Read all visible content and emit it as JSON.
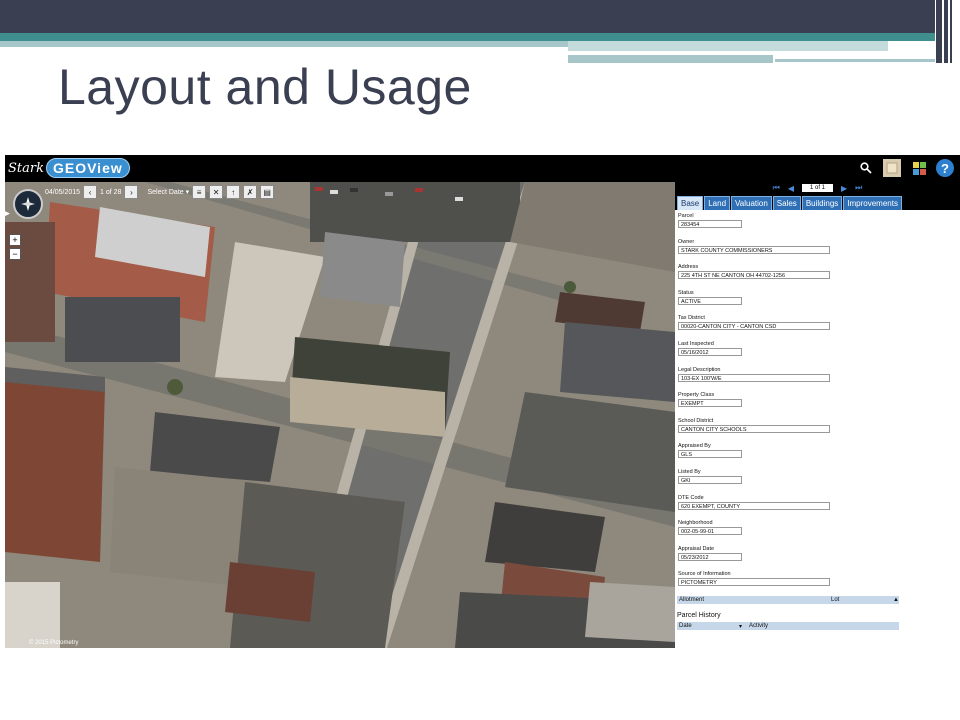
{
  "slide": {
    "title": "Layout and Usage"
  },
  "app": {
    "logo_stark": "Stark",
    "logo_geo": "GEOView"
  },
  "header_icons": {
    "search": "search-icon",
    "layers": "layers-icon",
    "grid": "grid-icon",
    "help_label": "?"
  },
  "map": {
    "date": "04/05/2015",
    "page_label": "1 of 28",
    "select_date": "Select Date",
    "zoom_in": "+",
    "zoom_out": "−",
    "copyright": "© 2015 Pictometry"
  },
  "pager": {
    "label": "1 of 1"
  },
  "tabs": [
    "Base",
    "Land",
    "Valuation",
    "Sales",
    "Buildings",
    "Improvements"
  ],
  "fields": [
    {
      "label": "Parcel",
      "value": "283454",
      "size": "short"
    },
    {
      "label": "Owner",
      "value": "STARK COUNTY COMMISSIONERS",
      "size": "long"
    },
    {
      "label": "Address",
      "value": "225 4TH ST NE CANTON OH 44702-1256",
      "size": "long"
    },
    {
      "label": "Status",
      "value": "ACTIVE",
      "size": "short"
    },
    {
      "label": "Tax District",
      "value": "00020-CANTON CITY - CANTON CSD",
      "size": "long"
    },
    {
      "label": "Last Inspected",
      "value": "05/16/2012",
      "size": "short"
    },
    {
      "label": "Legal Description",
      "value": "103-EX 100'W/E",
      "size": "long"
    },
    {
      "label": "Property Class",
      "value": "EXEMPT",
      "size": "short"
    },
    {
      "label": "School District",
      "value": "CANTON CITY SCHOOLS",
      "size": "long"
    },
    {
      "label": "Appraised By",
      "value": "GLS",
      "size": "short"
    },
    {
      "label": "Listed By",
      "value": "GKI",
      "size": "short"
    },
    {
      "label": "DTE Code",
      "value": "620 EXEMPT, COUNTY",
      "size": "long"
    },
    {
      "label": "Neighborhood",
      "value": "002-05-99-01",
      "size": "short"
    },
    {
      "label": "Appraisal Date",
      "value": "05/23/2012",
      "size": "short"
    },
    {
      "label": "Source of Information",
      "value": "PICTOMETRY",
      "size": "long"
    }
  ],
  "allotment": {
    "col1": "Allotment",
    "col2": "Lot"
  },
  "parcel_history": {
    "title": "Parcel History",
    "col1": "Date",
    "col2": "Activity"
  }
}
